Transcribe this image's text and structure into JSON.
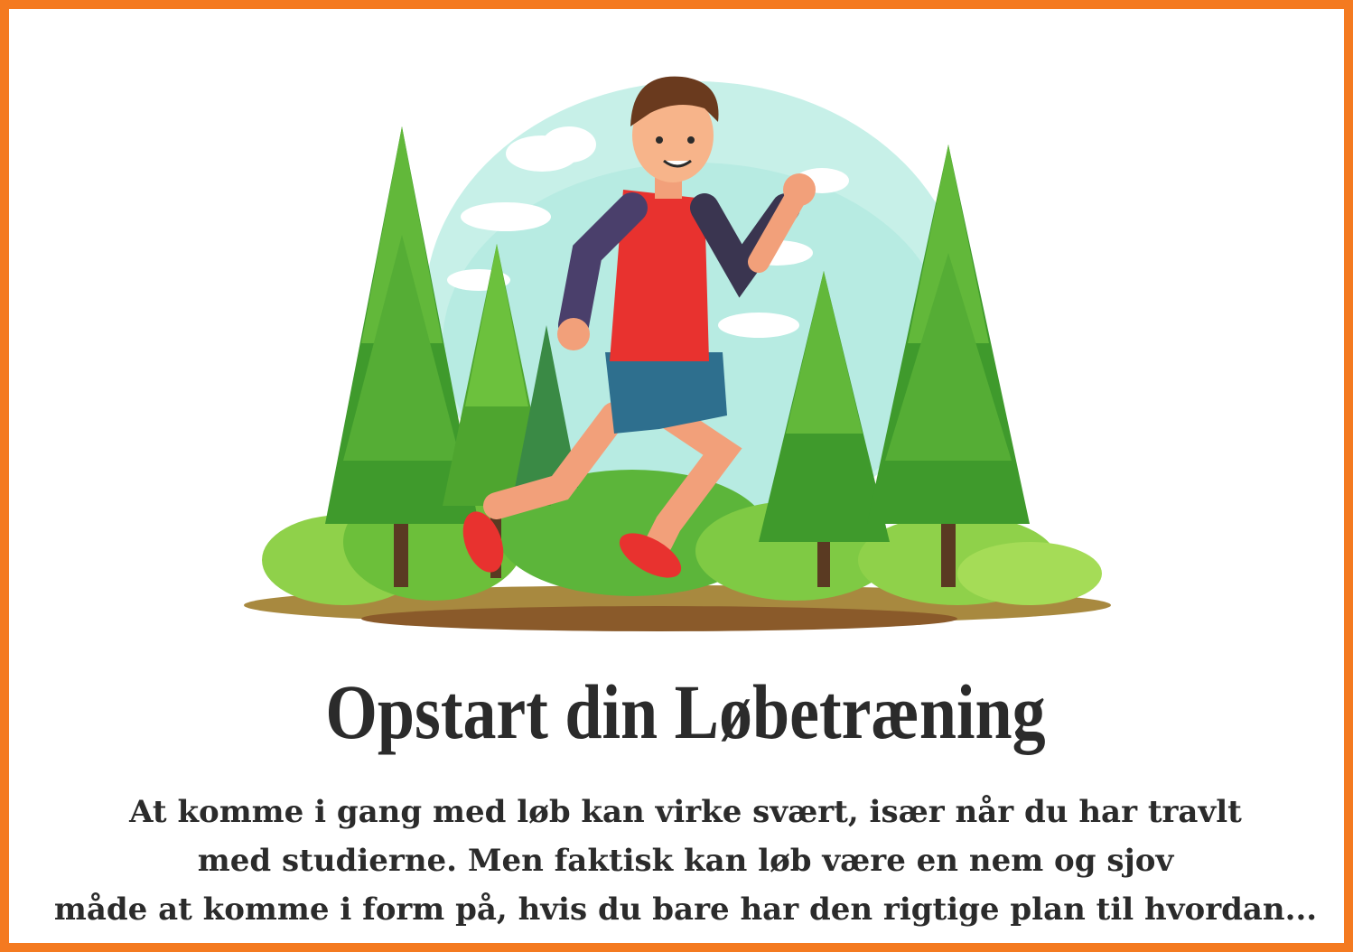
{
  "title": "Opstart din Løbetræning",
  "body": {
    "line1": "At komme i gang med løb kan virke svært, især når du har travlt",
    "line2": "med studierne. Men faktisk kan løb være en nem og sjov",
    "line3": "måde at komme i form på, hvis du bare har den rigtige plan til hvordan..."
  },
  "colors": {
    "border": "#f47a20",
    "text": "#2b2b2b",
    "sky": "#bfeee6",
    "tree": "#4fa52b",
    "shirt": "#e8322f",
    "shorts": "#2e6f8e",
    "ground": "#9a7a3a"
  },
  "icons": {
    "illustration": "runner-in-forest-illustration"
  }
}
